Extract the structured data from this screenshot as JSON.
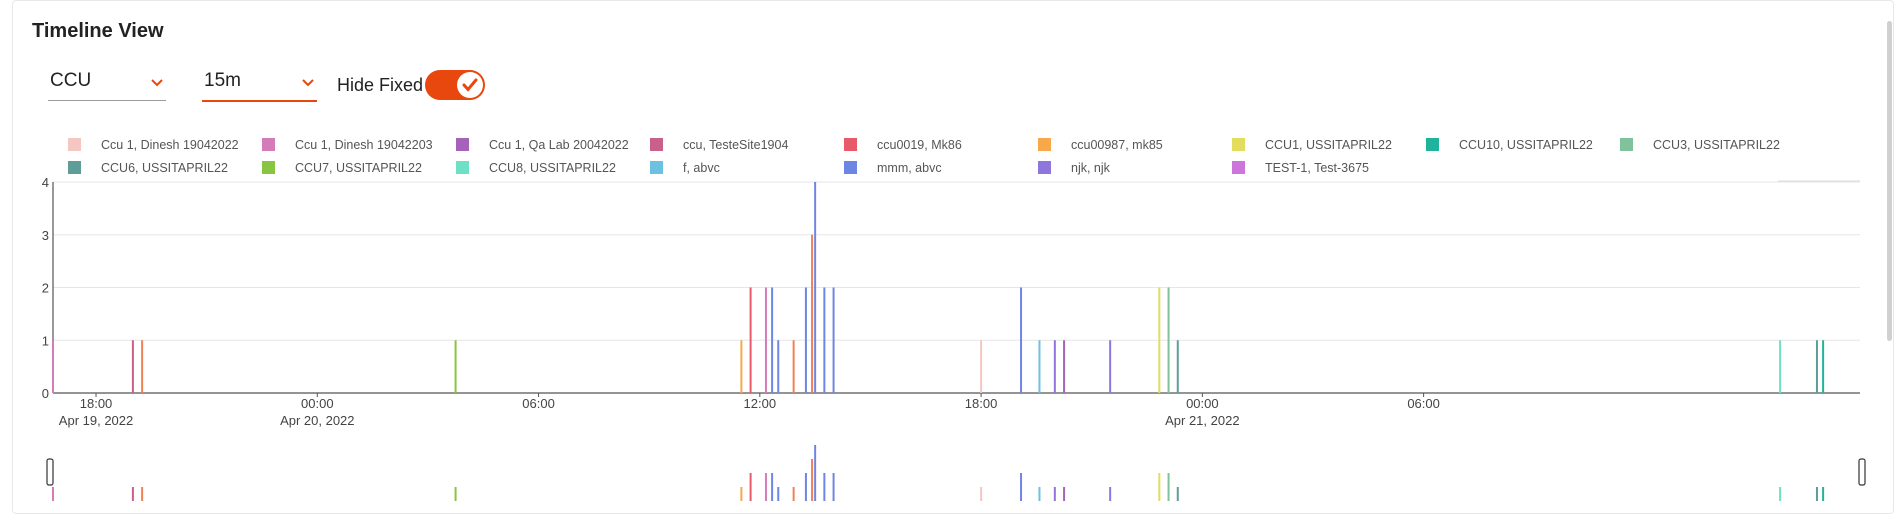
{
  "header": {
    "title": "Timeline View"
  },
  "controls": {
    "ccu_select": {
      "value": "CCU"
    },
    "interval_select": {
      "value": "15m"
    },
    "hide_fixed": {
      "label": "Hide Fixed",
      "on": true
    }
  },
  "colors": {
    "accent": "#e8470d",
    "axis": "#555555",
    "grid": "#e6e6e6"
  },
  "icons": {
    "chevron": "chevron-down-icon",
    "toggle_check": "check-icon"
  },
  "chart_data": {
    "type": "bar",
    "x_axis": "time",
    "y_ticks": [
      "0",
      "1",
      "2",
      "3",
      "4"
    ],
    "ylim": [
      0,
      4
    ],
    "xlim": [
      "2022-04-19T16:50",
      "2022-04-21T17:50"
    ],
    "x_ticks": [
      {
        "time": "2022-04-19T18:00",
        "label": "18:00",
        "sublabel": "Apr 19, 2022"
      },
      {
        "time": "2022-04-20T00:00",
        "label": "00:00",
        "sublabel": "Apr 20, 2022"
      },
      {
        "time": "2022-04-20T06:00",
        "label": "06:00",
        "sublabel": ""
      },
      {
        "time": "2022-04-20T12:00",
        "label": "12:00",
        "sublabel": ""
      },
      {
        "time": "2022-04-20T18:00",
        "label": "18:00",
        "sublabel": ""
      },
      {
        "time": "2022-04-21T00:00",
        "label": "00:00",
        "sublabel": "Apr 21, 2022"
      },
      {
        "time": "2022-04-21T06:00",
        "label": "06:00",
        "sublabel": ""
      }
    ],
    "legend": [
      {
        "name": "Ccu 1, Dinesh 19042022",
        "color": "#f4c7c3"
      },
      {
        "name": "Ccu 1, Dinesh 19042203",
        "color": "#d47bb9"
      },
      {
        "name": "Ccu 1, Qa Lab 20042022",
        "color": "#a463b8"
      },
      {
        "name": "ccu, TesteSite1904",
        "color": "#c9608a"
      },
      {
        "name": "ccu0019, Mk86",
        "color": "#e85a6a"
      },
      {
        "name": "ccu00987, mk85",
        "color": "#f7a84a"
      },
      {
        "name": "CCU1, USSITAPRIL22",
        "color": "#e2dd5c"
      },
      {
        "name": "CCU10, USSITAPRIL22",
        "color": "#1fb39c"
      },
      {
        "name": "CCU3, USSITAPRIL22",
        "color": "#7fc29b"
      },
      {
        "name": "CCU6, USSITAPRIL22",
        "color": "#5f9e98"
      },
      {
        "name": "CCU7, USSITAPRIL22",
        "color": "#88c540"
      },
      {
        "name": "CCU8, USSITAPRIL22",
        "color": "#6ee0c4"
      },
      {
        "name": "f, abvc",
        "color": "#6cc0e0"
      },
      {
        "name": "mmm, abvc",
        "color": "#6e86e3"
      },
      {
        "name": "njk, njk",
        "color": "#8e76de"
      },
      {
        "name": "TEST-1, Test-3675",
        "color": "#cc76dd"
      }
    ],
    "events": [
      {
        "time": "2022-04-19T16:50",
        "value": 1,
        "color": "#d47bb9"
      },
      {
        "time": "2022-04-19T19:00",
        "value": 1,
        "color": "#c9608a"
      },
      {
        "time": "2022-04-19T19:15",
        "value": 1,
        "color": "#f08055"
      },
      {
        "time": "2022-04-20T03:45",
        "value": 1,
        "color": "#88c540"
      },
      {
        "time": "2022-04-20T11:30",
        "value": 1,
        "color": "#f7a84a"
      },
      {
        "time": "2022-04-20T11:45",
        "value": 2,
        "color": "#e85a6a"
      },
      {
        "time": "2022-04-20T12:10",
        "value": 2,
        "color": "#d47bb9"
      },
      {
        "time": "2022-04-20T12:20",
        "value": 2,
        "color": "#6e86e3"
      },
      {
        "time": "2022-04-20T12:30",
        "value": 1,
        "color": "#6e86e3"
      },
      {
        "time": "2022-04-20T12:55",
        "value": 1,
        "color": "#f08055"
      },
      {
        "time": "2022-04-20T13:15",
        "value": 2,
        "color": "#6e86e3"
      },
      {
        "time": "2022-04-20T13:25",
        "value": 3,
        "color": "#f08055"
      },
      {
        "time": "2022-04-20T13:30",
        "value": 4,
        "color": "#6e86e3"
      },
      {
        "time": "2022-04-20T13:45",
        "value": 2,
        "color": "#6e86e3"
      },
      {
        "time": "2022-04-20T14:00",
        "value": 2,
        "color": "#6e86e3"
      },
      {
        "time": "2022-04-20T18:00",
        "value": 1,
        "color": "#f4c7c3"
      },
      {
        "time": "2022-04-20T19:05",
        "value": 2,
        "color": "#6e86e3"
      },
      {
        "time": "2022-04-20T19:35",
        "value": 1,
        "color": "#6cc0e0"
      },
      {
        "time": "2022-04-20T20:00",
        "value": 1,
        "color": "#8e76de"
      },
      {
        "time": "2022-04-20T20:15",
        "value": 1,
        "color": "#a463b8"
      },
      {
        "time": "2022-04-20T21:30",
        "value": 1,
        "color": "#8e76de"
      },
      {
        "time": "2022-04-20T22:50",
        "value": 2,
        "color": "#e2dd5c"
      },
      {
        "time": "2022-04-20T23:05",
        "value": 2,
        "color": "#7fc29b"
      },
      {
        "time": "2022-04-20T23:20",
        "value": 1,
        "color": "#5f9e98"
      },
      {
        "time": "2022-04-21T15:40",
        "value": 1,
        "color": "#6ee0c4"
      },
      {
        "time": "2022-04-21T16:40",
        "value": 1,
        "color": "#5f9e98"
      },
      {
        "time": "2022-04-21T16:50",
        "value": 1,
        "color": "#1fb39c"
      }
    ]
  }
}
